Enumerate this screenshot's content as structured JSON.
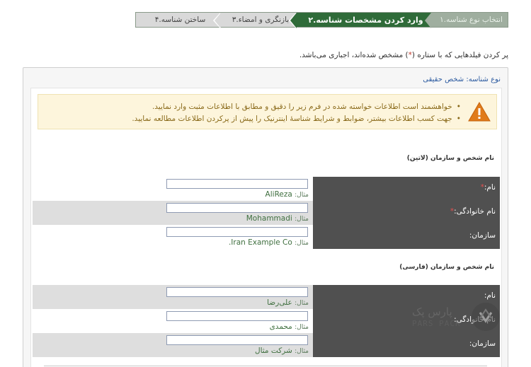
{
  "steps": [
    {
      "num": "۱.",
      "label": "انتخاب نوع شناسه"
    },
    {
      "num": "۲.",
      "label": "وارد کردن مشخصات شناسه"
    },
    {
      "num": "۳.",
      "label": "بازنگری و امضاء"
    },
    {
      "num": "۴.",
      "label": "ساختن شناسه"
    }
  ],
  "required_note": {
    "before": "پر کردن فیلدهایی که با ستاره (",
    "star": "*",
    "after": ") مشخص شده‌اند، اجباری می‌باشد."
  },
  "panel_title": "نوع شناسه: شخص حقیقی",
  "warning": {
    "icon": "warning-triangle-icon",
    "items": [
      "خواهشمند است اطلاعات خواسته شده در فرم زیر را دقیق و مطابق با اطلاعات مثبت وارد نمایید.",
      "جهت کسب اطلاعات بیشتر، ضوابط و شرایط شناسهٔ اینترنیک را پیش از پرکردن اطلاعات مطالعه نمایید."
    ]
  },
  "section_latin": {
    "title": "نام شخص و سازمان (لاتین)",
    "rows": [
      {
        "label": "نام:",
        "required": true,
        "value": "",
        "example_label": "مثال:",
        "example": "AliReza"
      },
      {
        "label": "نام خانوادگی:",
        "required": true,
        "value": "",
        "example_label": "مثال:",
        "example": "Mohammadi"
      },
      {
        "label": "سازمان:",
        "required": false,
        "value": "",
        "example_label": "مثال:",
        "example": "Iran Example Co."
      }
    ]
  },
  "section_farsi": {
    "title": "نام شخص و سازمان (فارسی)",
    "rows": [
      {
        "label": "نام:",
        "required": false,
        "value": "",
        "example_label": "مثال:",
        "example": "علی‌رضا"
      },
      {
        "label": "نام خانوادگی:",
        "required": false,
        "value": "",
        "example_label": "مثال:",
        "example": "محمدی"
      },
      {
        "label": "سازمان:",
        "required": false,
        "value": "",
        "example_label": "مثال:",
        "example": "شرکت مثال"
      }
    ]
  },
  "watermark": {
    "text_fa": "پارس پک",
    "text_en": "PARS PACK"
  },
  "colors": {
    "active_step": "#2f6b39",
    "label_bg": "#505050",
    "warning_bg": "#fdf5dc",
    "link": "#2b5aa0"
  }
}
